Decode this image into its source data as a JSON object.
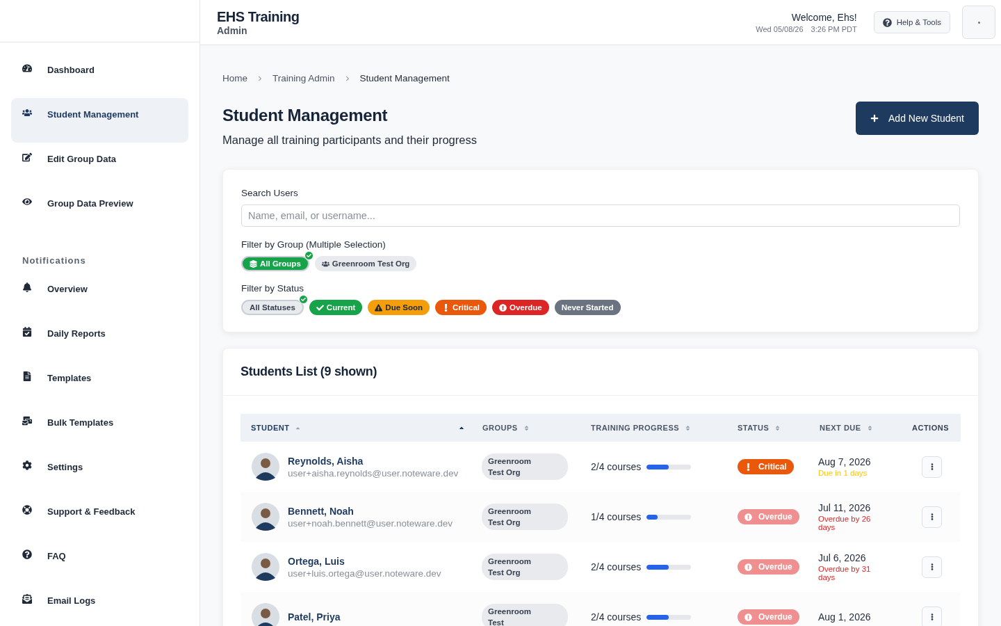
{
  "header": {
    "title": "EHS Training",
    "subtitle": "Admin",
    "welcome": "Welcome, Ehs!",
    "date": "Wed 05/08/26",
    "time": "3:26 PM PDT",
    "help_button": "Help & Tools"
  },
  "sidebar": {
    "items": [
      {
        "label": "Dashboard",
        "selected": false
      },
      {
        "label": "Student Management",
        "selected": true
      },
      {
        "label": "Edit Group Data",
        "selected": false
      },
      {
        "label": "Group Data Preview",
        "selected": false
      }
    ],
    "section_title": "Notifications",
    "notification_items": [
      {
        "label": "Overview",
        "selected": false
      },
      {
        "label": "Daily Reports",
        "selected": false
      },
      {
        "label": "Templates",
        "selected": false
      },
      {
        "label": "Bulk Templates",
        "selected": false
      },
      {
        "label": "Settings",
        "selected": false
      },
      {
        "label": "Support & Feedback",
        "selected": false
      },
      {
        "label": "FAQ",
        "selected": false
      },
      {
        "label": "Email Logs",
        "selected": false
      }
    ]
  },
  "breadcrumb": [
    "Home",
    "Training Admin",
    "Student Management"
  ],
  "page": {
    "title": "Student Management",
    "subtitle": "Manage all training participants and their progress",
    "add_button": "Add New Student"
  },
  "filters": {
    "search_label": "Search Users",
    "search_placeholder": "Name, email, or username...",
    "group_label": "Filter by Group (Multiple Selection)",
    "groups": [
      {
        "label": "All Groups",
        "kind": "all",
        "selected": true
      },
      {
        "label": "Greenroom Test Org",
        "kind": "group",
        "selected": false
      }
    ],
    "status_label": "Filter by Status",
    "statuses": [
      {
        "label": "All Statuses",
        "kind": "all",
        "selected": true
      },
      {
        "label": "Current",
        "kind": "current",
        "selected": false
      },
      {
        "label": "Due Soon",
        "kind": "due_soon",
        "selected": false
      },
      {
        "label": "Critical",
        "kind": "critical",
        "selected": false
      },
      {
        "label": "Overdue",
        "kind": "overdue",
        "selected": false
      },
      {
        "label": "Never Started",
        "kind": "never",
        "selected": false
      }
    ]
  },
  "students": {
    "title": "Students List (9 shown)",
    "columns": [
      {
        "label": "STUDENT",
        "sortable": true,
        "sorted": true
      },
      {
        "label": "GROUPS",
        "sortable": true,
        "sorted": false
      },
      {
        "label": "TRAINING PROGRESS",
        "sortable": true,
        "sorted": false
      },
      {
        "label": "STATUS",
        "sortable": true,
        "sorted": false
      },
      {
        "label": "NEXT DUE",
        "sortable": true,
        "sorted": false
      },
      {
        "label": "ACTIONS",
        "sortable": false,
        "sorted": false
      }
    ],
    "rows": [
      {
        "name": "Reynolds, Aisha",
        "email": "user+aisha.reynolds@user.noteware.dev",
        "group": "Greenroom Test Org",
        "progress": "2/4 courses",
        "level": 0.5,
        "status": {
          "label": "Critical",
          "kind": "critical"
        },
        "due_date": "Aug 7, 2026",
        "due_note": {
          "text": "Due in 1 days",
          "kind": "soon"
        }
      },
      {
        "name": "Bennett, Noah",
        "email": "user+noah.bennett@user.noteware.dev",
        "group": "Greenroom Test Org",
        "progress": "1/4 courses",
        "level": 0.25,
        "status": {
          "label": "Overdue",
          "kind": "overdue"
        },
        "due_date": "Jul 11, 2026",
        "due_note": {
          "text": "Overdue by 26 days",
          "kind": "overdue"
        }
      },
      {
        "name": "Ortega, Luis",
        "email": "user+luis.ortega@user.noteware.dev",
        "group": "Greenroom Test Org",
        "progress": "2/4 courses",
        "level": 0.5,
        "status": {
          "label": "Overdue",
          "kind": "overdue"
        },
        "due_date": "Jul 6, 2026",
        "due_note": {
          "text": "Overdue by 31 days",
          "kind": "overdue"
        }
      },
      {
        "name": "Patel, Priya",
        "group": "Greenroom Test",
        "progress": "2/4 courses",
        "level": 0.5,
        "status": {
          "label": "Overdue",
          "kind": "overdue"
        },
        "due_date": "Aug 1, 2026"
      }
    ]
  }
}
